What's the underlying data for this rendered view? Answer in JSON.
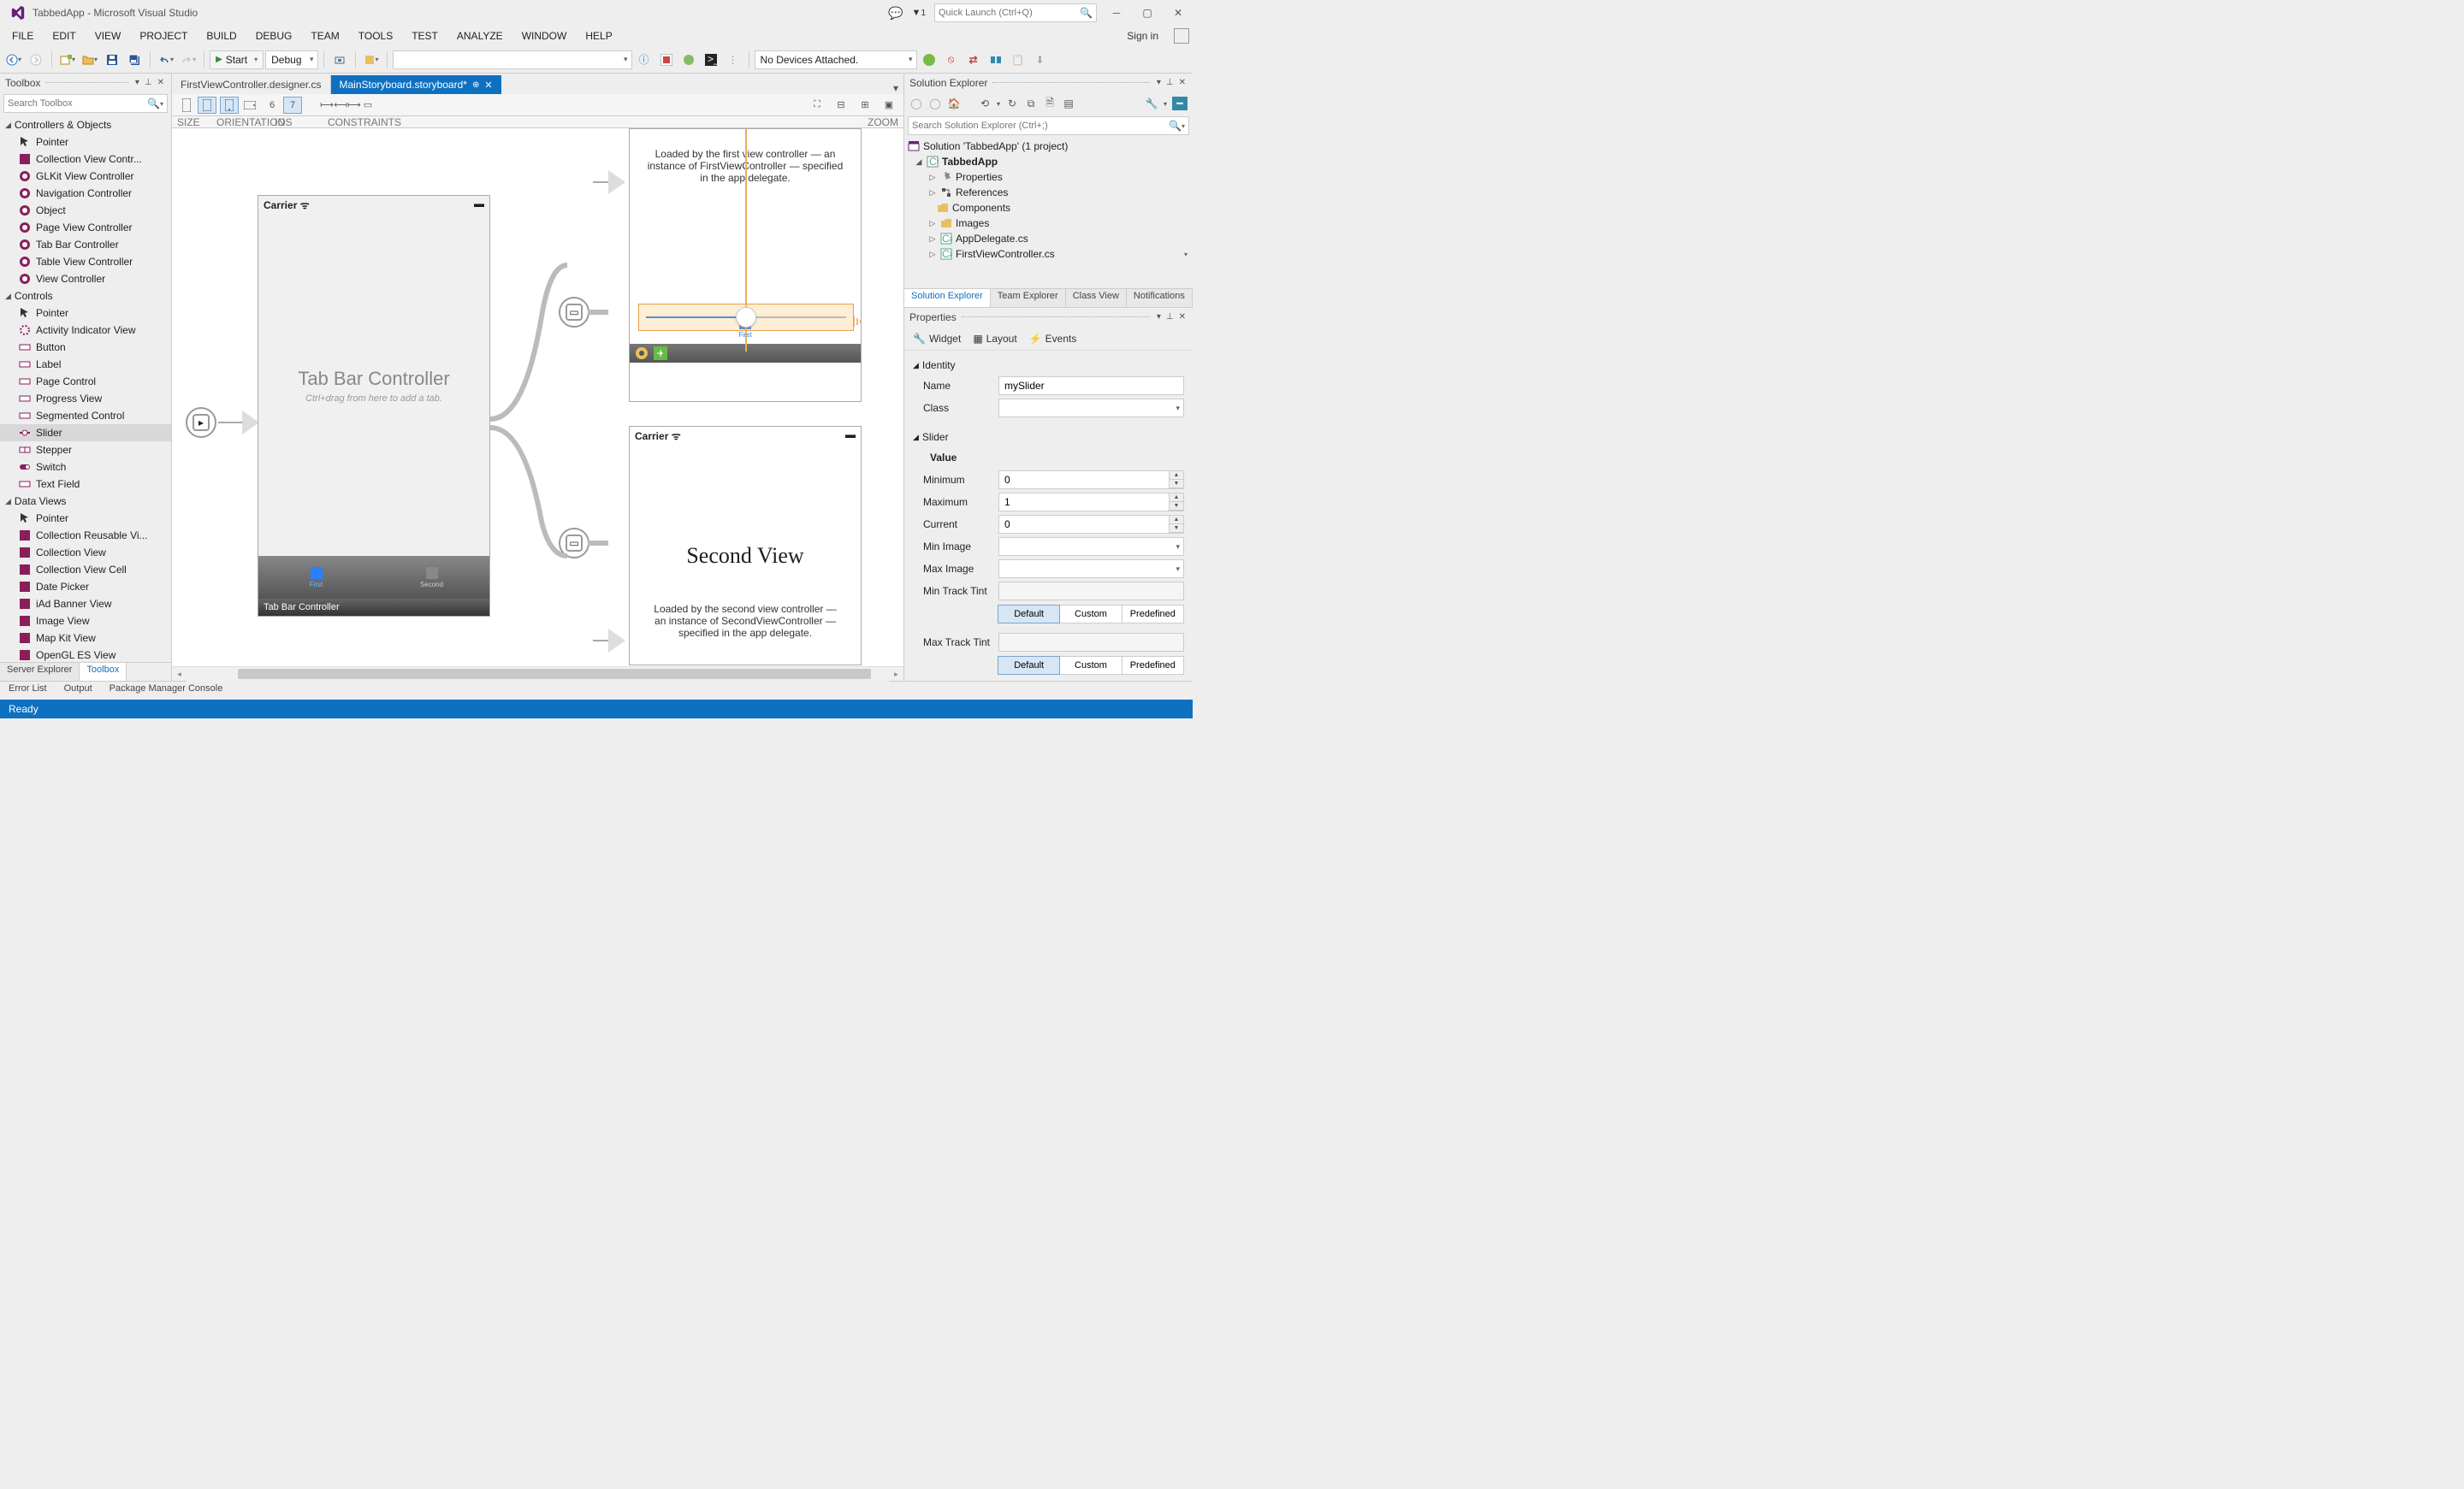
{
  "title": {
    "app": "TabbedApp",
    "suffix": " - Microsoft Visual Studio"
  },
  "quicklaunch_placeholder": "Quick Launch (Ctrl+Q)",
  "notif_count": "1",
  "menu": [
    "FILE",
    "EDIT",
    "VIEW",
    "PROJECT",
    "BUILD",
    "DEBUG",
    "TEAM",
    "TOOLS",
    "TEST",
    "ANALYZE",
    "WINDOW",
    "HELP"
  ],
  "signin": "Sign in",
  "toolbar": {
    "start": "Start",
    "config": "Debug",
    "devices": "No Devices Attached."
  },
  "toolbox": {
    "title": "Toolbox",
    "search_placeholder": "Search Toolbox",
    "groups": [
      {
        "name": "Controllers & Objects",
        "items": [
          "Pointer",
          "Collection View Contr...",
          "GLKit View Controller",
          "Navigation Controller",
          "Object",
          "Page View Controller",
          "Tab Bar Controller",
          "Table View Controller",
          "View Controller"
        ]
      },
      {
        "name": "Controls",
        "items": [
          "Pointer",
          "Activity Indicator View",
          "Button",
          "Label",
          "Page Control",
          "Progress View",
          "Segmented Control",
          "Slider",
          "Stepper",
          "Switch",
          "Text Field"
        ]
      },
      {
        "name": "Data Views",
        "items": [
          "Pointer",
          "Collection Reusable Vi...",
          "Collection View",
          "Collection View Cell",
          "Date Picker",
          "iAd Banner View",
          "Image View",
          "Map Kit View",
          "OpenGL ES View"
        ]
      }
    ],
    "tabs": [
      "Server Explorer",
      "Toolbox"
    ]
  },
  "doctabs": [
    {
      "label": "FirstViewController.designer.cs",
      "active": false
    },
    {
      "label": "MainStoryboard.storyboard*",
      "active": true
    }
  ],
  "designer": {
    "labels": {
      "size": "SIZE",
      "orient": "ORIENTATION",
      "ios": "IOS VERSION",
      "constraints": "CONSTRAINTS",
      "zoom": "ZOOM"
    },
    "ios6": "6",
    "ios7": "7"
  },
  "canvas": {
    "carrier": "Carrier",
    "wifi": "ᯤ",
    "batt": "▬",
    "tbc_title": "Tab Bar Controller",
    "tbc_sub": "Ctrl+drag from here to add a tab.",
    "tbc_caption": "Tab Bar Controller",
    "tabs": {
      "first": "First",
      "second": "Second"
    },
    "first_desc": "Loaded by the first view controller — an instance of FirstViewController — specified in the app delegate.",
    "first_lbl": "First",
    "second_title": "Second View",
    "second_desc": "Loaded by the second view controller — an instance of SecondViewController — specified in the app delegate."
  },
  "solution": {
    "title": "Solution Explorer",
    "search_placeholder": "Search Solution Explorer (Ctrl+;)",
    "root": "Solution 'TabbedApp' (1 project)",
    "project": "TabbedApp",
    "nodes": [
      "Properties",
      "References",
      "Components",
      "Images",
      "AppDelegate.cs",
      "FirstViewController.cs"
    ],
    "tabs": [
      "Solution Explorer",
      "Team Explorer",
      "Class View",
      "Notifications"
    ]
  },
  "props": {
    "title": "Properties",
    "tabs": [
      "Widget",
      "Layout",
      "Events"
    ],
    "identity": {
      "section": "Identity",
      "name_lbl": "Name",
      "name_val": "mySlider",
      "class_lbl": "Class",
      "class_val": ""
    },
    "slider": {
      "section": "Slider",
      "value": "Value",
      "rows": {
        "min_lbl": "Minimum",
        "min_val": "0",
        "max_lbl": "Maximum",
        "max_val": "1",
        "cur_lbl": "Current",
        "cur_val": "0",
        "minimg_lbl": "Min Image",
        "maximg_lbl": "Max Image",
        "mintint_lbl": "Min Track Tint",
        "maxtint_lbl": "Max Track Tint"
      },
      "tint_btns": [
        "Default",
        "Custom",
        "Predefined"
      ]
    }
  },
  "bottom_tabs": [
    "Error List",
    "Output",
    "Package Manager Console"
  ],
  "status": "Ready"
}
